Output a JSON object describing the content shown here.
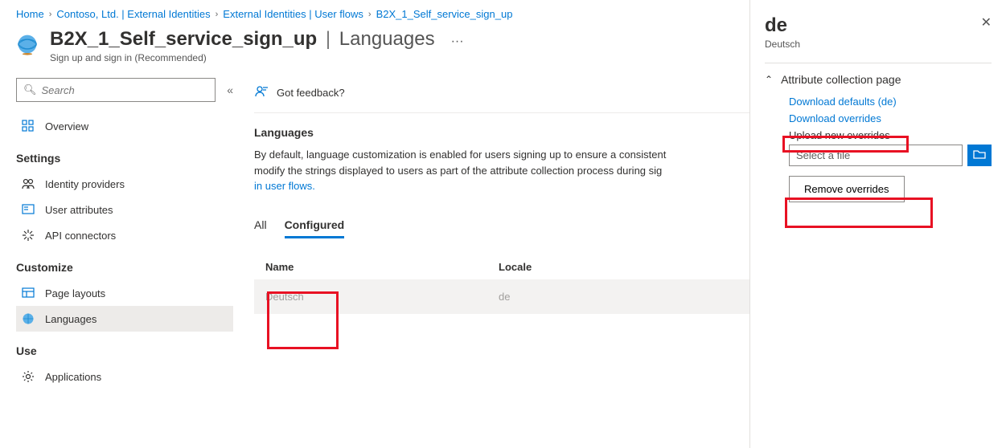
{
  "breadcrumb": {
    "items": [
      {
        "label": "Home"
      },
      {
        "label": "Contoso, Ltd. | External Identities"
      },
      {
        "label": "External Identities | User flows"
      },
      {
        "label": "B2X_1_Self_service_sign_up"
      }
    ]
  },
  "header": {
    "title": "B2X_1_Self_service_sign_up",
    "subtitle": "Languages",
    "desc": "Sign up and sign in (Recommended)"
  },
  "search": {
    "placeholder": "Search"
  },
  "sidebar": {
    "overview": "Overview",
    "settings_label": "Settings",
    "settings": [
      "Identity providers",
      "User attributes",
      "API connectors"
    ],
    "customize_label": "Customize",
    "customize": [
      "Page layouts",
      "Languages"
    ],
    "use_label": "Use",
    "use": [
      "Applications"
    ]
  },
  "feedback": "Got feedback?",
  "main": {
    "section_title": "Languages",
    "body": "By default, language customization is enabled for users signing up to ensure a consistent",
    "body2": "modify the strings displayed to users as part of the attribute collection process during sig",
    "body_link": "in user flows.",
    "tabs": {
      "all": "All",
      "configured": "Configured"
    },
    "table": {
      "headers": {
        "name": "Name",
        "locale": "Locale"
      },
      "rows": [
        {
          "name": "Deutsch",
          "locale": "de"
        }
      ]
    }
  },
  "panel": {
    "title": "de",
    "subtitle": "Deutsch",
    "acc_title": "Attribute collection page",
    "download_defaults": "Download defaults (de)",
    "download_overrides": "Download overrides",
    "upload_label": "Upload new overrides",
    "file_placeholder": "Select a file",
    "remove": "Remove overrides"
  }
}
